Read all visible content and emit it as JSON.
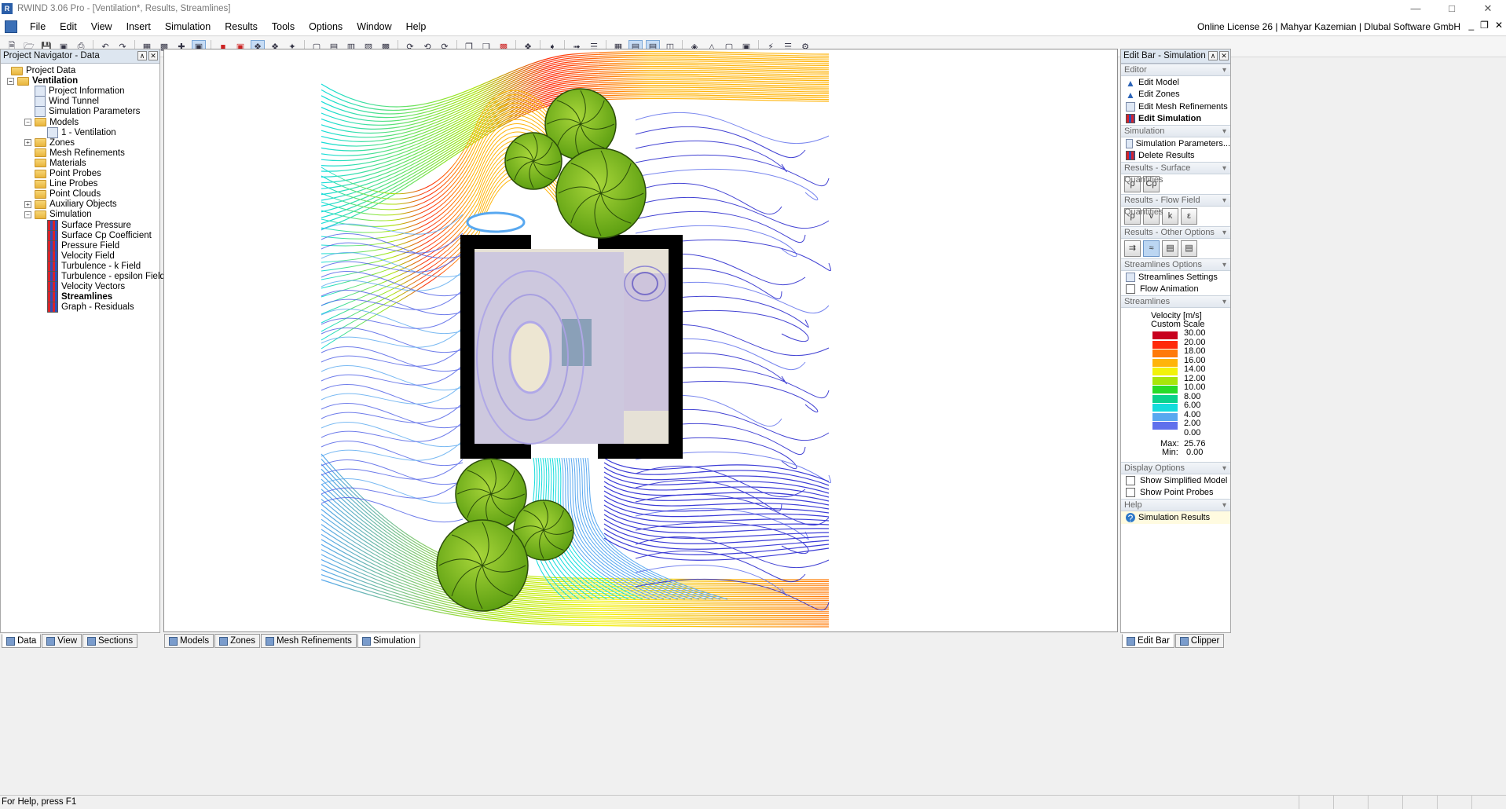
{
  "window": {
    "title": "RWIND 3.06 Pro - [Ventilation*, Results, Streamlines]",
    "app_icon": "rwind-app-icon"
  },
  "menu": {
    "items": [
      "File",
      "Edit",
      "View",
      "Insert",
      "Simulation",
      "Results",
      "Tools",
      "Options",
      "Window",
      "Help"
    ],
    "license": "Online License 26 | Mahyar Kazemian | Dlubal Software GmbH"
  },
  "navigator": {
    "title": "Project Navigator - Data",
    "tree": [
      {
        "label": "Project Data",
        "level": 0,
        "icon": "folder-icon",
        "bold": false,
        "exp": ""
      },
      {
        "label": "Ventilation",
        "level": 1,
        "icon": "folder-icon",
        "bold": true,
        "exp": "−"
      },
      {
        "label": "Project Information",
        "level": 2,
        "icon": "info-icon",
        "bold": false,
        "exp": ""
      },
      {
        "label": "Wind Tunnel",
        "level": 2,
        "icon": "tunnel-icon",
        "bold": false,
        "exp": ""
      },
      {
        "label": "Simulation Parameters",
        "level": 2,
        "icon": "params-icon",
        "bold": false,
        "exp": ""
      },
      {
        "label": "Models",
        "level": 2,
        "icon": "folder-icon",
        "bold": false,
        "exp": "−"
      },
      {
        "label": "1 - Ventilation",
        "level": 3,
        "icon": "model-icon",
        "bold": false,
        "exp": ""
      },
      {
        "label": "Zones",
        "level": 2,
        "icon": "folder-icon",
        "bold": false,
        "exp": "+"
      },
      {
        "label": "Mesh Refinements",
        "level": 2,
        "icon": "folder-icon",
        "bold": false,
        "exp": ""
      },
      {
        "label": "Materials",
        "level": 2,
        "icon": "folder-icon",
        "bold": false,
        "exp": ""
      },
      {
        "label": "Point Probes",
        "level": 2,
        "icon": "folder-icon",
        "bold": false,
        "exp": ""
      },
      {
        "label": "Line Probes",
        "level": 2,
        "icon": "folder-icon",
        "bold": false,
        "exp": ""
      },
      {
        "label": "Point Clouds",
        "level": 2,
        "icon": "folder-icon",
        "bold": false,
        "exp": ""
      },
      {
        "label": "Auxiliary Objects",
        "level": 2,
        "icon": "folder-icon",
        "bold": false,
        "exp": "+"
      },
      {
        "label": "Simulation",
        "level": 2,
        "icon": "folder-icon",
        "bold": false,
        "exp": "−"
      },
      {
        "label": "Surface Pressure",
        "level": 3,
        "icon": "result-icon",
        "bold": false,
        "exp": ""
      },
      {
        "label": "Surface Cp Coefficient",
        "level": 3,
        "icon": "result-icon",
        "bold": false,
        "exp": ""
      },
      {
        "label": "Pressure Field",
        "level": 3,
        "icon": "result-icon",
        "bold": false,
        "exp": ""
      },
      {
        "label": "Velocity Field",
        "level": 3,
        "icon": "result-icon",
        "bold": false,
        "exp": ""
      },
      {
        "label": "Turbulence - k Field",
        "level": 3,
        "icon": "result-icon",
        "bold": false,
        "exp": ""
      },
      {
        "label": "Turbulence - epsilon Field",
        "level": 3,
        "icon": "result-icon",
        "bold": false,
        "exp": ""
      },
      {
        "label": "Velocity Vectors",
        "level": 3,
        "icon": "result-icon",
        "bold": false,
        "exp": ""
      },
      {
        "label": "Streamlines",
        "level": 3,
        "icon": "result-icon",
        "bold": true,
        "exp": ""
      },
      {
        "label": "Graph - Residuals",
        "level": 3,
        "icon": "result-icon",
        "bold": false,
        "exp": ""
      }
    ],
    "tabs": [
      "Data",
      "View",
      "Sections"
    ]
  },
  "viewport_tabs": [
    "Models",
    "Zones",
    "Mesh Refinements",
    "Simulation"
  ],
  "editbar": {
    "title": "Edit Bar - Simulation",
    "editor_header": "Editor",
    "editor_items": [
      "Edit Model",
      "Edit Zones",
      "Edit Mesh Refinements",
      "Edit Simulation"
    ],
    "simulation_header": "Simulation",
    "simulation_items": [
      "Simulation Parameters...",
      "Delete Results"
    ],
    "surface_header": "Results - Surface Quantities",
    "surface_buttons": [
      "p",
      "Cp"
    ],
    "flow_header": "Results - Flow Field Quantities",
    "flow_buttons": [
      "p",
      "v",
      "k",
      "ε"
    ],
    "other_header": "Results - Other Options",
    "streamline_options_header": "Streamlines Options",
    "streamline_options": [
      "Streamlines Settings",
      "Flow Animation"
    ],
    "streamlines_header": "Streamlines",
    "legend_title": "Velocity [m/s]",
    "legend_subtitle": "Custom Scale",
    "legend_values": [
      "30.00",
      "20.00",
      "18.00",
      "16.00",
      "14.00",
      "12.00",
      "10.00",
      "8.00",
      "6.00",
      "4.00",
      "2.00",
      "0.00"
    ],
    "legend_colors": [
      "#c8001e",
      "#ff2a0a",
      "#ff7a0a",
      "#ffb40a",
      "#f2f20a",
      "#a8e60a",
      "#28dc28",
      "#0ad28c",
      "#14dcdc",
      "#58a8f0",
      "#6070ec",
      "#1414d8"
    ],
    "max_label": "Max:",
    "max_value": "25.76",
    "min_label": "Min:",
    "min_value": "0.00",
    "display_header": "Display Options",
    "display_options": [
      "Show Simplified Model",
      "Show Point Probes"
    ],
    "help_header": "Help",
    "help_item": "Simulation Results",
    "tabs": [
      "Edit Bar",
      "Clipper"
    ]
  },
  "status": {
    "text": "For Help, press F1"
  }
}
